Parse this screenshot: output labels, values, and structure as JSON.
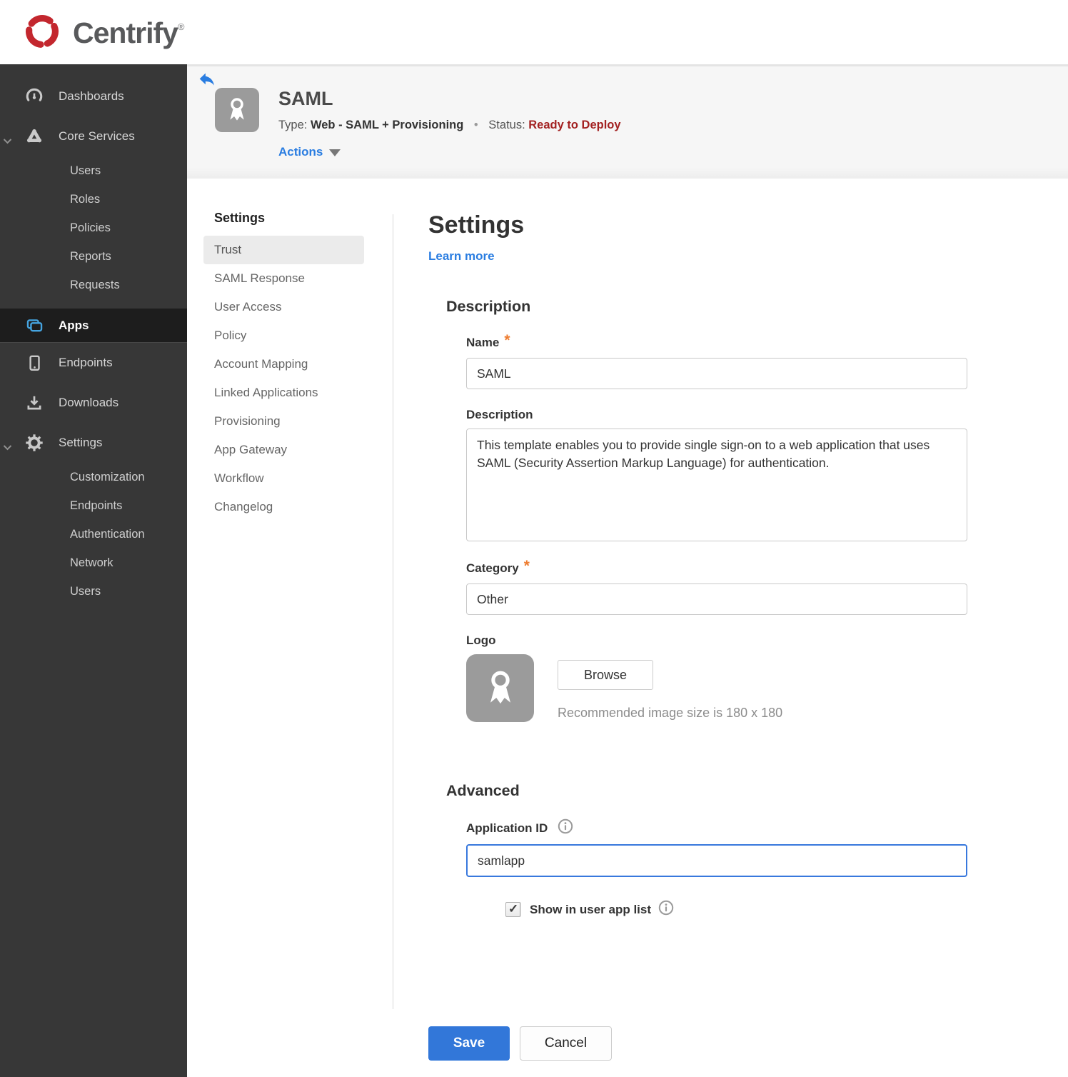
{
  "brand": {
    "name": "Centrify",
    "registered_mark": "®"
  },
  "sidebar": {
    "items": [
      {
        "label": "Dashboards"
      },
      {
        "label": "Core Services",
        "expanded": true,
        "children": [
          "Users",
          "Roles",
          "Policies",
          "Reports",
          "Requests"
        ]
      },
      {
        "label": "Apps",
        "active": true
      },
      {
        "label": "Endpoints"
      },
      {
        "label": "Downloads"
      },
      {
        "label": "Settings",
        "expanded": true,
        "children": [
          "Customization",
          "Endpoints",
          "Authentication",
          "Network",
          "Users"
        ]
      }
    ]
  },
  "app_header": {
    "title": "SAML",
    "type_label": "Type:",
    "type_value": "Web - SAML + Provisioning",
    "separator": "•",
    "status_label": "Status:",
    "status_value": "Ready to Deploy",
    "actions_label": "Actions"
  },
  "subnav": {
    "header": "Settings",
    "active_item": "Trust",
    "items": [
      "Trust",
      "SAML Response",
      "User Access",
      "Policy",
      "Account Mapping",
      "Linked Applications",
      "Provisioning",
      "App Gateway",
      "Workflow",
      "Changelog"
    ]
  },
  "main": {
    "heading": "Settings",
    "learn_more_label": "Learn more",
    "required_marker": "*",
    "description": {
      "heading": "Description",
      "name_label": "Name",
      "name_value": "SAML",
      "description_label": "Description",
      "description_value": "This template enables you to provide single sign-on to a web application that uses SAML (Security Assertion Markup Language) for authentication.",
      "category_label": "Category",
      "category_value": "Other",
      "logo_label": "Logo",
      "browse_button_label": "Browse",
      "logo_hint": "Recommended image size is 180 x 180"
    },
    "advanced": {
      "heading": "Advanced",
      "application_id_label": "Application ID",
      "application_id_value": "samlapp",
      "show_in_user_app_list_label": "Show in user app list",
      "show_in_user_app_list_checked": true
    },
    "buttons": {
      "save_label": "Save",
      "cancel_label": "Cancel"
    }
  },
  "colors": {
    "accent_blue": "#2a7de1",
    "save_button_blue": "#3277d9",
    "status_red": "#a32222",
    "apps_icon_blue": "#45a4e0",
    "required_orange": "#ee7c2f",
    "sidebar_bg": "#373737",
    "sidebar_active_bg": "#1d1d1d"
  }
}
